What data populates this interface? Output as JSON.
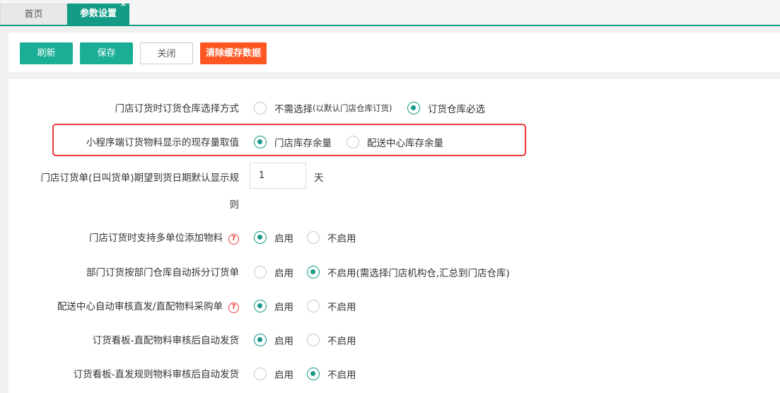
{
  "tabs": {
    "home": "首页",
    "active": "参数设置",
    "close_glyph": "×"
  },
  "toolbar": {
    "refresh": "刷新",
    "save": "保存",
    "close": "关闭",
    "clear_cache": "清除缓存数据"
  },
  "settings": [
    {
      "label": "门店订货时订货仓库选择方式",
      "options": [
        {
          "label": "不需选择",
          "note": "(以默认门店仓库订货)",
          "selected": false
        },
        {
          "label": "订货仓库必选",
          "selected": true
        }
      ]
    },
    {
      "label": "小程序端订货物料显示的现存量取值",
      "options": [
        {
          "label": "门店库存余量",
          "selected": true
        },
        {
          "label": "配送中心库存余量",
          "selected": false
        }
      ]
    },
    {
      "label_line1": "门店订货单(日叫货单)期望到货日期默认显示规",
      "label_line2": "则",
      "value": "1",
      "unit": "天"
    },
    {
      "label": "门店订货时支持多单位添加物料",
      "help": "?",
      "options": [
        {
          "label": "启用",
          "selected": true
        },
        {
          "label": "不启用",
          "selected": false
        }
      ]
    },
    {
      "label": "部门订货按部门仓库自动拆分订货单",
      "options": [
        {
          "label": "启用",
          "selected": false
        },
        {
          "label": "不启用(需选择门店机构仓,汇总到门店仓库)",
          "selected": true
        }
      ]
    },
    {
      "label": "配送中心自动审核直发/直配物料采购单",
      "help": "?",
      "options": [
        {
          "label": "启用",
          "selected": true
        },
        {
          "label": "不启用",
          "selected": false
        }
      ]
    },
    {
      "label": "订货看板-直配物料审核后自动发货",
      "options": [
        {
          "label": "启用",
          "selected": true
        },
        {
          "label": "不启用",
          "selected": false
        }
      ]
    },
    {
      "label": "订货看板-直发规则物料审核后自动发货",
      "options": [
        {
          "label": "启用",
          "selected": false
        },
        {
          "label": "不启用",
          "selected": true
        }
      ]
    }
  ],
  "colors": {
    "accent": "#149b86",
    "danger": "#ff5722",
    "highlight": "#e53935"
  }
}
